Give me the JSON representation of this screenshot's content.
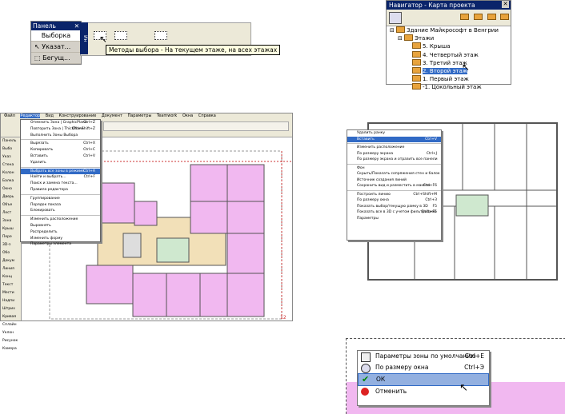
{
  "toolbox": {
    "title": "Панель",
    "close": "✕",
    "items": [
      "Выборка",
      "Указат...",
      "Бегущ..."
    ]
  },
  "method_strip": {
    "side_label": "Ин",
    "tooltip": "Методы выбора - На текущем этаже, на всех этажах"
  },
  "navigator": {
    "title": "Навигатор - Карта проекта",
    "close": "✕",
    "tree": [
      "Здание Майкрософт в Венгрии",
      "Этажи",
      "5. Крыша",
      "4. Четвертый этаж",
      "3. Третий этаж",
      "2. Второй этаж",
      "1. Первый этаж",
      "-1. Цокольный этаж"
    ]
  },
  "main_window": {
    "menu": [
      "Файл",
      "Редактор",
      "Вид",
      "Конструирование",
      "Документ",
      "Параметры",
      "Teamwork",
      "Окна",
      "Справка"
    ],
    "left_panel": [
      "Панель",
      "Выбо",
      "Указ",
      "Стена",
      "Колон",
      "Балка",
      "Окно",
      "Дверь",
      "Объе",
      "Лест",
      "Зона",
      "Крыш",
      "Пере",
      "3D-з",
      "Обо",
      "Докум",
      "Линия",
      "Конц",
      "Текст",
      "Мести",
      "Надпи",
      "Штрих",
      "Кривая",
      "Сплайн",
      "Уклон",
      "Рисунок",
      "Камера"
    ],
    "edit_menu": [
      {
        "label": "Отменить Зона | GraphicPlane",
        "key": "Ctrl+Z"
      },
      {
        "label": "Повторить Зона | ThickPlane",
        "key": "Ctrl+Shift+Z"
      },
      {
        "label": "Выполнить Зоны Выбора",
        "key": ""
      },
      {
        "label": "Вырезать",
        "key": "Ctrl+X"
      },
      {
        "label": "Копировать",
        "key": "Ctrl+C"
      },
      {
        "label": "Вставить",
        "key": "Ctrl+V"
      },
      {
        "label": "Удалить",
        "key": ""
      },
      {
        "label": "Выбрать все зоны в режиме",
        "key": "Ctrl+A"
      },
      {
        "label": "Найти и выбрать...",
        "key": "Ctrl+F"
      },
      {
        "label": "Поиск и замена текста...",
        "key": ""
      },
      {
        "label": "Правила редактора",
        "key": ""
      },
      {
        "label": "Группирование",
        "key": ""
      },
      {
        "label": "Порядок показа",
        "key": ""
      },
      {
        "label": "Блокировать",
        "key": ""
      },
      {
        "label": "Изменить расположение",
        "key": ""
      },
      {
        "label": "Выровнять",
        "key": ""
      },
      {
        "label": "Распределить",
        "key": ""
      },
      {
        "label": "Изменить форму",
        "key": ""
      },
      {
        "label": "Параметры элемента",
        "key": ""
      }
    ],
    "scale": "12"
  },
  "context_menu": [
    {
      "label": "Удалить ранку",
      "key": ""
    },
    {
      "label": "Вставить",
      "key": "Ctrl+V"
    },
    {
      "label": "Изменить расположение",
      "key": ""
    },
    {
      "label": "По размеру экрана",
      "key": "Ctrl+J"
    },
    {
      "label": "По размеру экрана и отразить все панели",
      "key": ""
    },
    {
      "label": "Фон",
      "key": ""
    },
    {
      "label": "Скрыть/Показать сопряжения стен и балок",
      "key": ""
    },
    {
      "label": "Источник создания линий",
      "key": ""
    },
    {
      "label": "Сохранить вид и разместить в макете",
      "key": "Ctrl+F6"
    },
    {
      "label": "Построить линию",
      "key": "Ctrl+Shift+M"
    },
    {
      "label": "По размеру окна",
      "key": "Ctrl+З"
    },
    {
      "label": "Показать выбор/текущую рамку в 3D",
      "key": "F5"
    },
    {
      "label": "Показать все в 3D с учетом фильтрацией",
      "key": "Shift+F5"
    },
    {
      "label": "Параметры",
      "key": ""
    }
  ],
  "bottom_menu": [
    {
      "label": "Параметры зоны по умолчанию",
      "key": "Ctrl+E"
    },
    {
      "label": "По размеру окна",
      "key": "Ctrl+Э"
    },
    {
      "label": "ОК",
      "key": ""
    },
    {
      "label": "Отменить",
      "key": ""
    }
  ],
  "colors": {
    "title_bar": "#0a246a",
    "highlight": "#316ac5",
    "zone_fill": "#f1b8f0",
    "corridor_fill": "#f2e0b8"
  }
}
